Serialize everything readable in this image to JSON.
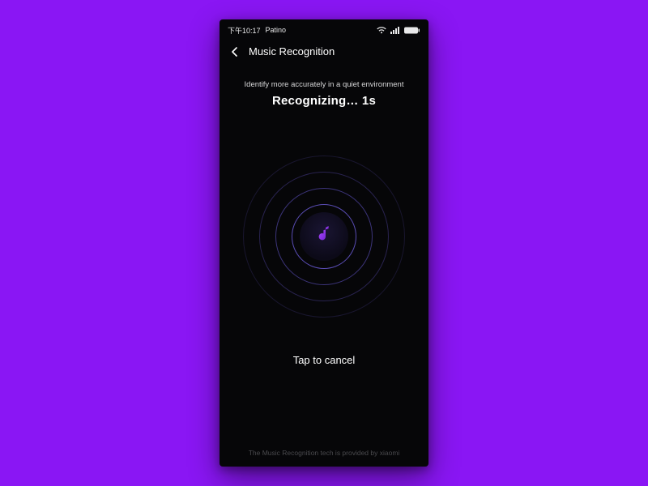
{
  "statusbar": {
    "time": "下午10:17",
    "carrier": "Patino"
  },
  "nav": {
    "title": "Music Recognition"
  },
  "main": {
    "hint": "Identify more accurately in a quiet environment",
    "status": "Recognizing… 1s",
    "cancel": "Tap to cancel"
  },
  "footer": {
    "credit": "The Music Recognition tech is provided by xiaomi"
  },
  "colors": {
    "background": "#8a16f4",
    "phone": "#060608",
    "accent": "#8a2cf0",
    "ring": "#5a4db5"
  }
}
